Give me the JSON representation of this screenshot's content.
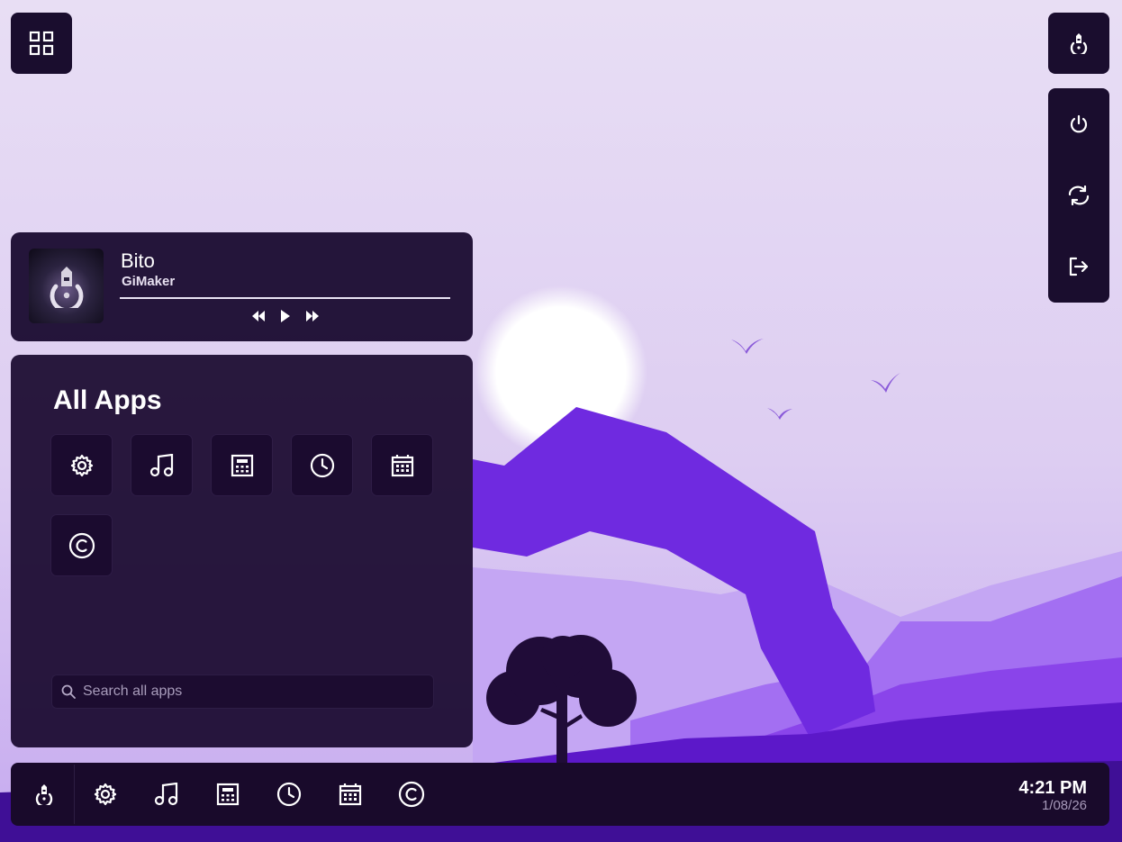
{
  "wallpaper": {
    "colors": {
      "sky_top": "#e6dcf3",
      "sky_bottom": "#cdb7ef",
      "sun": "#ffffff",
      "rock": "#6a27d8",
      "hills_far": "#b79af1",
      "hills_mid": "#9b5af0",
      "hills_near": "#6d22d6",
      "tree": "#1f0d35"
    }
  },
  "topbar": {
    "apps_toggle_icon": "grid-icon",
    "logo_icon": "gimaker-logo-icon"
  },
  "power_menu": {
    "items": [
      {
        "icon": "power-icon"
      },
      {
        "icon": "restart-icon"
      },
      {
        "icon": "logout-icon"
      }
    ]
  },
  "media_player": {
    "title": "Bito",
    "artist": "GiMaker",
    "progress": 1.0,
    "controls": [
      "rewind-icon",
      "play-icon",
      "fast-forward-icon"
    ]
  },
  "all_apps": {
    "heading": "All Apps",
    "apps": [
      {
        "icon": "settings-icon"
      },
      {
        "icon": "music-icon"
      },
      {
        "icon": "calculator-icon"
      },
      {
        "icon": "clock-icon"
      },
      {
        "icon": "calendar-icon"
      },
      {
        "icon": "copyright-icon"
      }
    ],
    "search_placeholder": "Search all apps"
  },
  "taskbar": {
    "items": [
      {
        "icon": "gimaker-logo-icon"
      },
      {
        "icon": "settings-icon"
      },
      {
        "icon": "music-icon"
      },
      {
        "icon": "calculator-icon"
      },
      {
        "icon": "clock-icon"
      },
      {
        "icon": "calendar-icon"
      },
      {
        "icon": "copyright-icon"
      }
    ],
    "time": "4:21 PM",
    "date": "1/08/26"
  },
  "colors": {
    "panel": "#1a0d2e",
    "accent_text": "#ffffff",
    "muted_text": "#a699b9"
  }
}
